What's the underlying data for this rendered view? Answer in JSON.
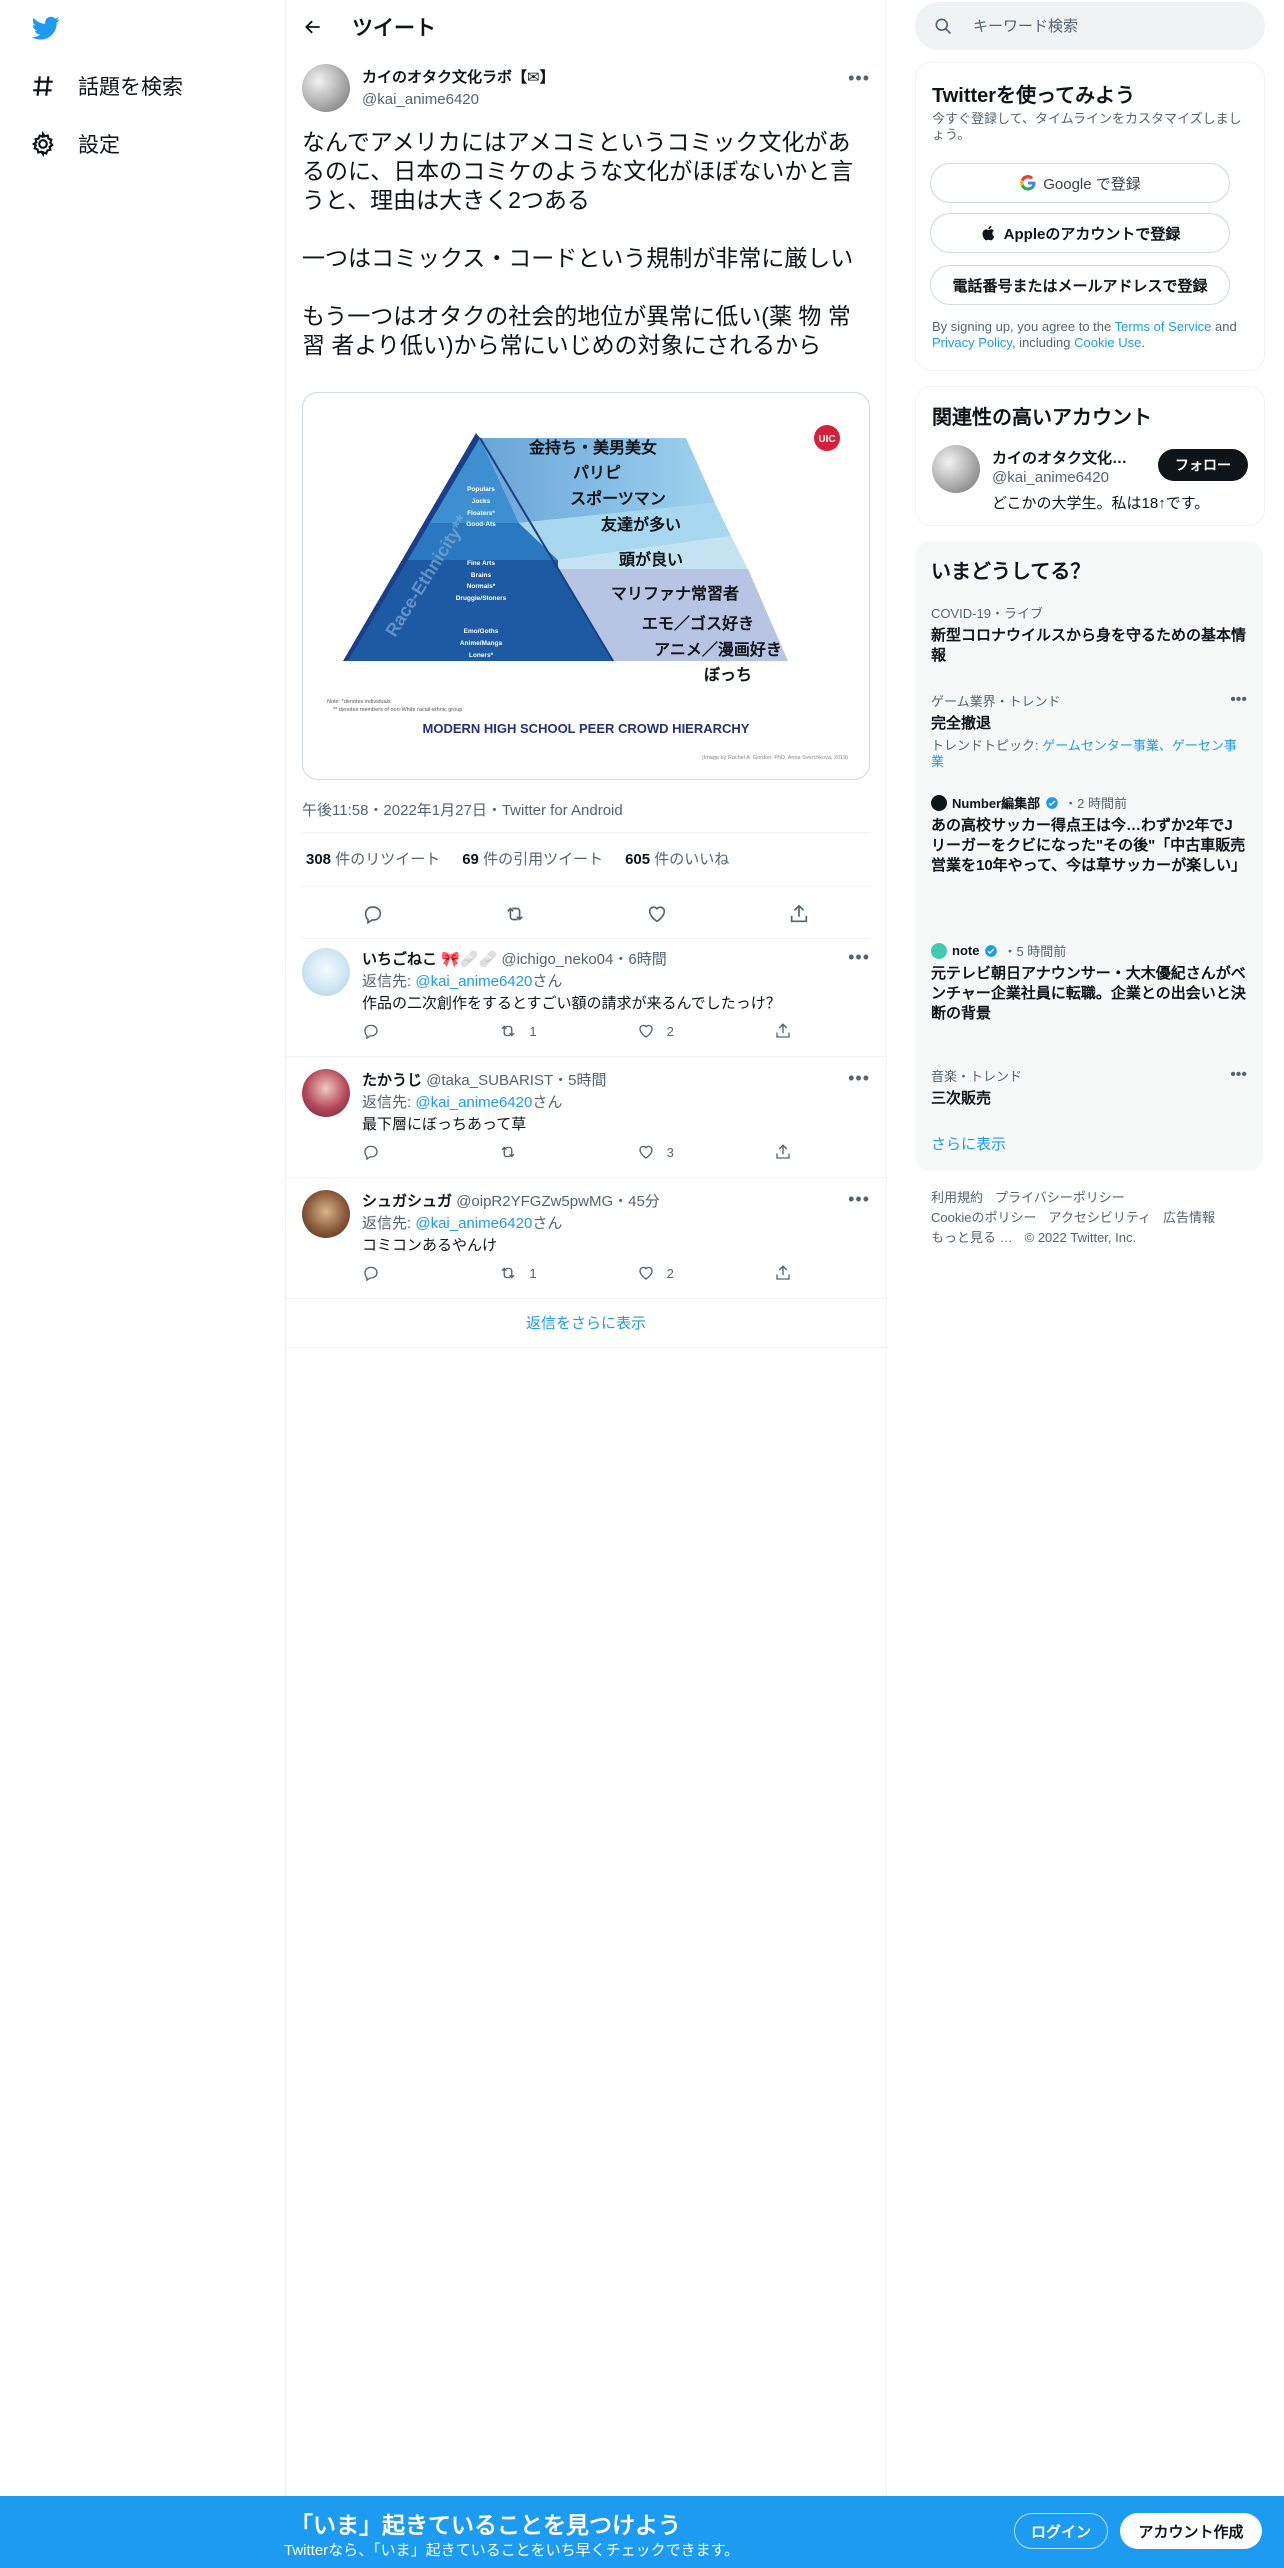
{
  "nav": {
    "explore_label": "話題を検索",
    "settings_label": "設定"
  },
  "header": {
    "title": "ツイート"
  },
  "tweet": {
    "author_name": "カイのオタク文化ラボ【✉】",
    "author_handle": "@kai_anime6420",
    "text": "なんでアメリカにはアメコミというコミック文化があるのに、日本のコミケのような文化がほぼないかと言うと、理由は大きく2つある\n\n一つはコミックス・コードという規制が非常に厳しい\n\nもう一つはオタクの社会的地位が異常に低い(薬 物 常習 者より低い)から常にいじめの対象にされるから",
    "meta": "午後11:58・2022年1月27日・Twitter for Android",
    "retweets_count": "308",
    "retweets_label": "件のリツイート",
    "quotes_count": "69",
    "quotes_label": "件の引用ツイート",
    "likes_count": "605",
    "likes_label": "件のいいね",
    "image": {
      "tiers": [
        "金持ち・美男美女",
        "パリピ",
        "スポーツマン",
        "友達が多い",
        "頭が良い",
        "マリファナ常習者",
        "エモ／ゴス好き",
        "アニメ／漫画好き",
        "ぼっち"
      ],
      "left_labels_1": [
        "Populars",
        "Jocks",
        "Floaters*",
        "Good-Ats"
      ],
      "left_labels_2": [
        "Fine Arts",
        "Brains",
        "Normals*",
        "Druggie/Stoners"
      ],
      "left_labels_3": [
        "Emo/Goths",
        "Anime/Manga",
        "Loners*"
      ],
      "side_label": "Race-Ethnicity**",
      "badge": "UIC",
      "note1": "Note: *denotes individuals",
      "note2": "** denotes members of non-White racial-ethnic group",
      "caption": "MODERN HIGH SCHOOL PEER CROWD HIERARCHY",
      "credit": "(Image by Rachel A. Gordon, PhD, Anna Sverchkova, 2019)"
    }
  },
  "replies": [
    {
      "name": "いちごねこ 🎀🩹🩹",
      "handle": "@ichigo_neko04",
      "time": "・6時間",
      "to_prefix": "返信先: ",
      "to_handle": "@kai_anime6420",
      "to_suffix": "さん",
      "text": "作品の二次創作をするとすごい額の請求が来るんでしたっけ？",
      "reply_count": "",
      "retweet_count": "1",
      "like_count": "2"
    },
    {
      "name": "たかうじ",
      "handle": "@taka_SUBARIST",
      "time": "・5時間",
      "to_prefix": "返信先: ",
      "to_handle": "@kai_anime6420",
      "to_suffix": "さん",
      "text": "最下層にぼっちあって草",
      "reply_count": "",
      "retweet_count": "",
      "like_count": "3"
    },
    {
      "name": "シュガシュガ",
      "handle": "@oipR2YFGZw5pwMG",
      "time": "・45分",
      "to_prefix": "返信先: ",
      "to_handle": "@kai_anime6420",
      "to_suffix": "さん",
      "text": "コミコンあるやんけ",
      "reply_count": "",
      "retweet_count": "1",
      "like_count": "2"
    }
  ],
  "show_more_replies": "返信をさらに表示",
  "search": {
    "placeholder": "キーワード検索"
  },
  "signup": {
    "title": "Twitterを使ってみよう",
    "subtitle": "今すぐ登録して、タイムラインをカスタマイズしましょう。",
    "google": "Google で登録",
    "apple": "Appleのアカウントで登録",
    "phone": "電話番号またはメールアドレスで登録",
    "terms_pre": "By signing up, you agree to the ",
    "terms_tos": "Terms of Service",
    "terms_and": " and ",
    "terms_privacy": "Privacy Policy",
    "terms_incl": ", including ",
    "terms_cookie": "Cookie Use",
    "terms_end": "."
  },
  "related": {
    "title": "関連性の高いアカウント",
    "name": "カイのオタク文化ラボ【✉】",
    "handle": "@kai_anime6420",
    "bio": "どこかの大学生。私は18↑です。",
    "follow": "フォロー"
  },
  "trends": {
    "title": "いまどうしてる？",
    "items": [
      {
        "context": "COVID-19・ライブ",
        "title": "新型コロナウイルスから身を守るための基本情報"
      },
      {
        "context": "ゲーム業界・トレンド",
        "title": "完全撤退",
        "topics_prefix": "トレンドトピック: ",
        "topics": "ゲームセンター事業、ゲーセン事業"
      },
      {
        "source": "Number編集部",
        "time": "・2 時間前",
        "title": "あの高校サッカー得点王は今…わずか2年でJリーガーをクビになった\"その後\"「中古車販売営業を10年やって、今は草サッカーが楽しい」"
      },
      {
        "source": "note",
        "time": "・5 時間前",
        "title": "元テレビ朝日アナウンサー・大木優紀さんがベンチャー企業社員に転職。企業との出会いと決断の背景"
      },
      {
        "context": "音楽・トレンド",
        "title": "三次販売"
      }
    ],
    "more": "さらに表示"
  },
  "footer": {
    "links": [
      "利用規約",
      "プライバシーポリシー",
      "Cookieのポリシー",
      "アクセシビリティ",
      "広告情報",
      "もっと見る …"
    ],
    "copyright": "© 2022 Twitter, Inc."
  },
  "bottombar": {
    "title": "「いま」起きていることを見つけよう",
    "subtitle": "Twitterなら、「いま」起きていることをいち早くチェックできます。",
    "login": "ログイン",
    "signup": "アカウント作成"
  },
  "colors": {
    "accent": "#1d9bf0",
    "text": "#0f1419",
    "muted": "#536471"
  }
}
